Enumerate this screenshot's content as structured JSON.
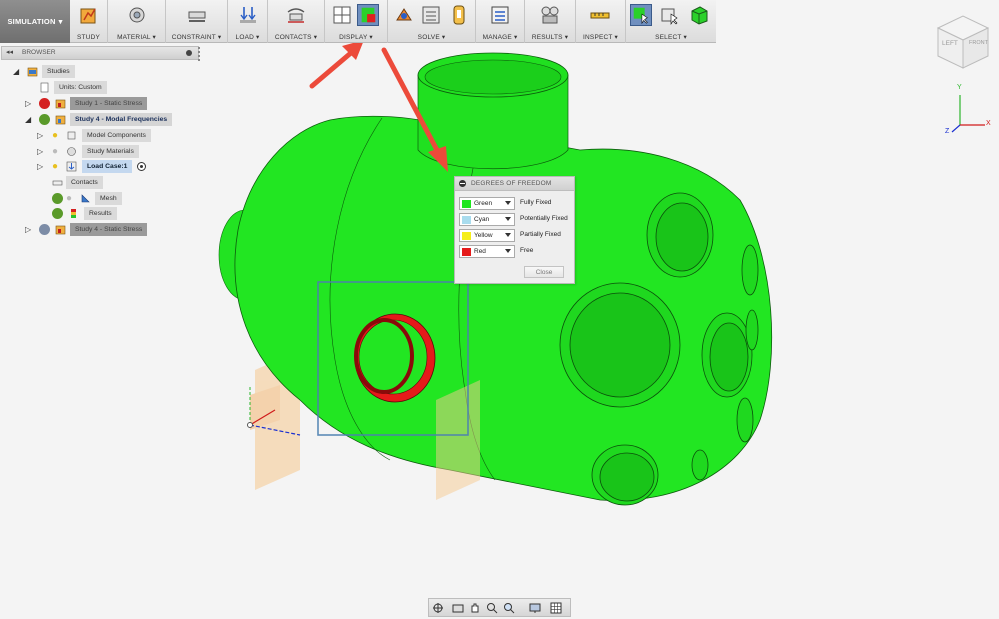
{
  "toolbar": {
    "workspace": "SIMULATION",
    "groups": [
      {
        "label": "STUDY"
      },
      {
        "label": "MATERIAL ▾"
      },
      {
        "label": "CONSTRAINT ▾"
      },
      {
        "label": "LOAD ▾"
      },
      {
        "label": "CONTACTS ▾"
      },
      {
        "label": "DISPLAY ▾"
      },
      {
        "label": "SOLVE ▾"
      },
      {
        "label": "MANAGE ▾"
      },
      {
        "label": "RESULTS ▾"
      },
      {
        "label": "INSPECT ▾"
      },
      {
        "label": "SELECT ▾"
      }
    ]
  },
  "browser": {
    "title": "BROWSER",
    "tree": [
      {
        "label": "Studies"
      },
      {
        "label": "Units: Custom"
      },
      {
        "label": "Study 1 - Static Stress"
      },
      {
        "label": "Study 4 - Modal Frequencies"
      },
      {
        "label": "Model Components"
      },
      {
        "label": "Study Materials"
      },
      {
        "label": "Load Case:1"
      },
      {
        "label": "Contacts"
      },
      {
        "label": "Mesh"
      },
      {
        "label": "Results"
      },
      {
        "label": "Study 4 - Static Stress"
      }
    ]
  },
  "dof_panel": {
    "title": "DEGREES OF FREEDOM",
    "rows": [
      {
        "option": "Green",
        "description": "Fully Fixed",
        "color": "#1ee61e"
      },
      {
        "option": "Cyan",
        "description": "Potentially Fixed",
        "color": "#a8dcee"
      },
      {
        "option": "Yellow",
        "description": "Partially Fixed",
        "color": "#f5ee1a"
      },
      {
        "option": "Red",
        "description": "Free",
        "color": "#e51a1a"
      }
    ],
    "close_label": "Close"
  },
  "viewcube": {
    "left_label": "LEFT",
    "front_label": "FRONT"
  },
  "axes": {
    "x": "X",
    "y": "Y",
    "z": "Z"
  },
  "colors": {
    "model": "#1ee61e",
    "free": "#e51a1a",
    "annotation_arrow": "#ec4a3a",
    "selection_box": "#4d7fb0"
  }
}
